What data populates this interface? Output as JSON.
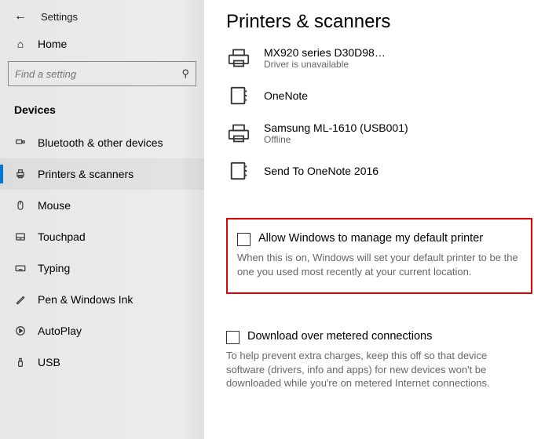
{
  "header": {
    "title": "Settings"
  },
  "home_label": "Home",
  "search": {
    "placeholder": "Find a setting"
  },
  "category_label": "Devices",
  "nav": [
    {
      "label": "Bluetooth & other devices"
    },
    {
      "label": "Printers & scanners"
    },
    {
      "label": "Mouse"
    },
    {
      "label": "Touchpad"
    },
    {
      "label": "Typing"
    },
    {
      "label": "Pen & Windows Ink"
    },
    {
      "label": "AutoPlay"
    },
    {
      "label": "USB"
    }
  ],
  "page_title": "Printers & scanners",
  "devices": [
    {
      "name": "MX920 series  D30D98…",
      "sub": "Driver is unavailable"
    },
    {
      "name": "OneNote",
      "sub": ""
    },
    {
      "name": "Samsung ML-1610 (USB001)",
      "sub": "Offline"
    },
    {
      "name": "Send To OneNote 2016",
      "sub": ""
    }
  ],
  "default_printer": {
    "label": "Allow Windows to manage my default printer",
    "desc": "When this is on, Windows will set your default printer to be the one you used most recently at your current location."
  },
  "metered": {
    "label": "Download over metered connections",
    "desc": "To help prevent extra charges, keep this off so that device software (drivers, info and apps) for new devices won't be downloaded while you're on metered Internet connections."
  }
}
